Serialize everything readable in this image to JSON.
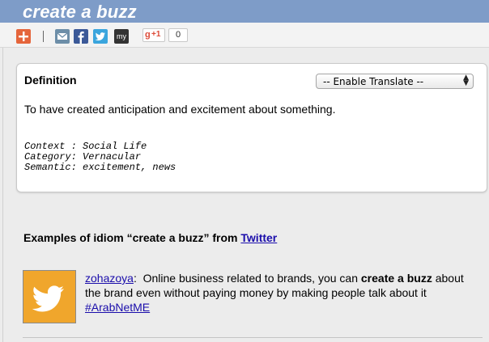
{
  "header": {
    "title": "create a buzz"
  },
  "share_bar": {
    "items": [
      {
        "icon": "addthis-plus-icon",
        "color": "#e5653b"
      },
      {
        "icon": "email-icon",
        "color": "#6d8ea8"
      },
      {
        "icon": "facebook-icon",
        "color": "#3b5998"
      },
      {
        "icon": "twitter-icon",
        "color": "#3aa5dd"
      },
      {
        "icon": "myspace-icon",
        "color": "#333333"
      }
    ],
    "gplus_label": "+1",
    "gplus_count": "0"
  },
  "definition": {
    "heading": "Definition",
    "translate_select": "-- Enable Translate --",
    "text": "To have created anticipation and excitement about something.",
    "context_label": "Context :",
    "context_value": "Social Life",
    "category_label": "Category:",
    "category_value": "Vernacular",
    "semantic_label": "Semantic:",
    "semantic_value": "excitement, news"
  },
  "examples": {
    "heading_prefix": "Examples of idiom “create a buzz” from",
    "source_link": "Twitter",
    "tweets": [
      {
        "user": "zohazoya",
        "text_before": "Online business related to brands, you can",
        "highlight": "create a buzz",
        "text_after": "about the brand even without paying money by making people talk about it",
        "hashtag": "#ArabNetME"
      }
    ]
  },
  "colors": {
    "title_bar": "#7e9cc8",
    "link": "#1a0dab",
    "twitter_avatar_bg": "#f0a62c"
  }
}
